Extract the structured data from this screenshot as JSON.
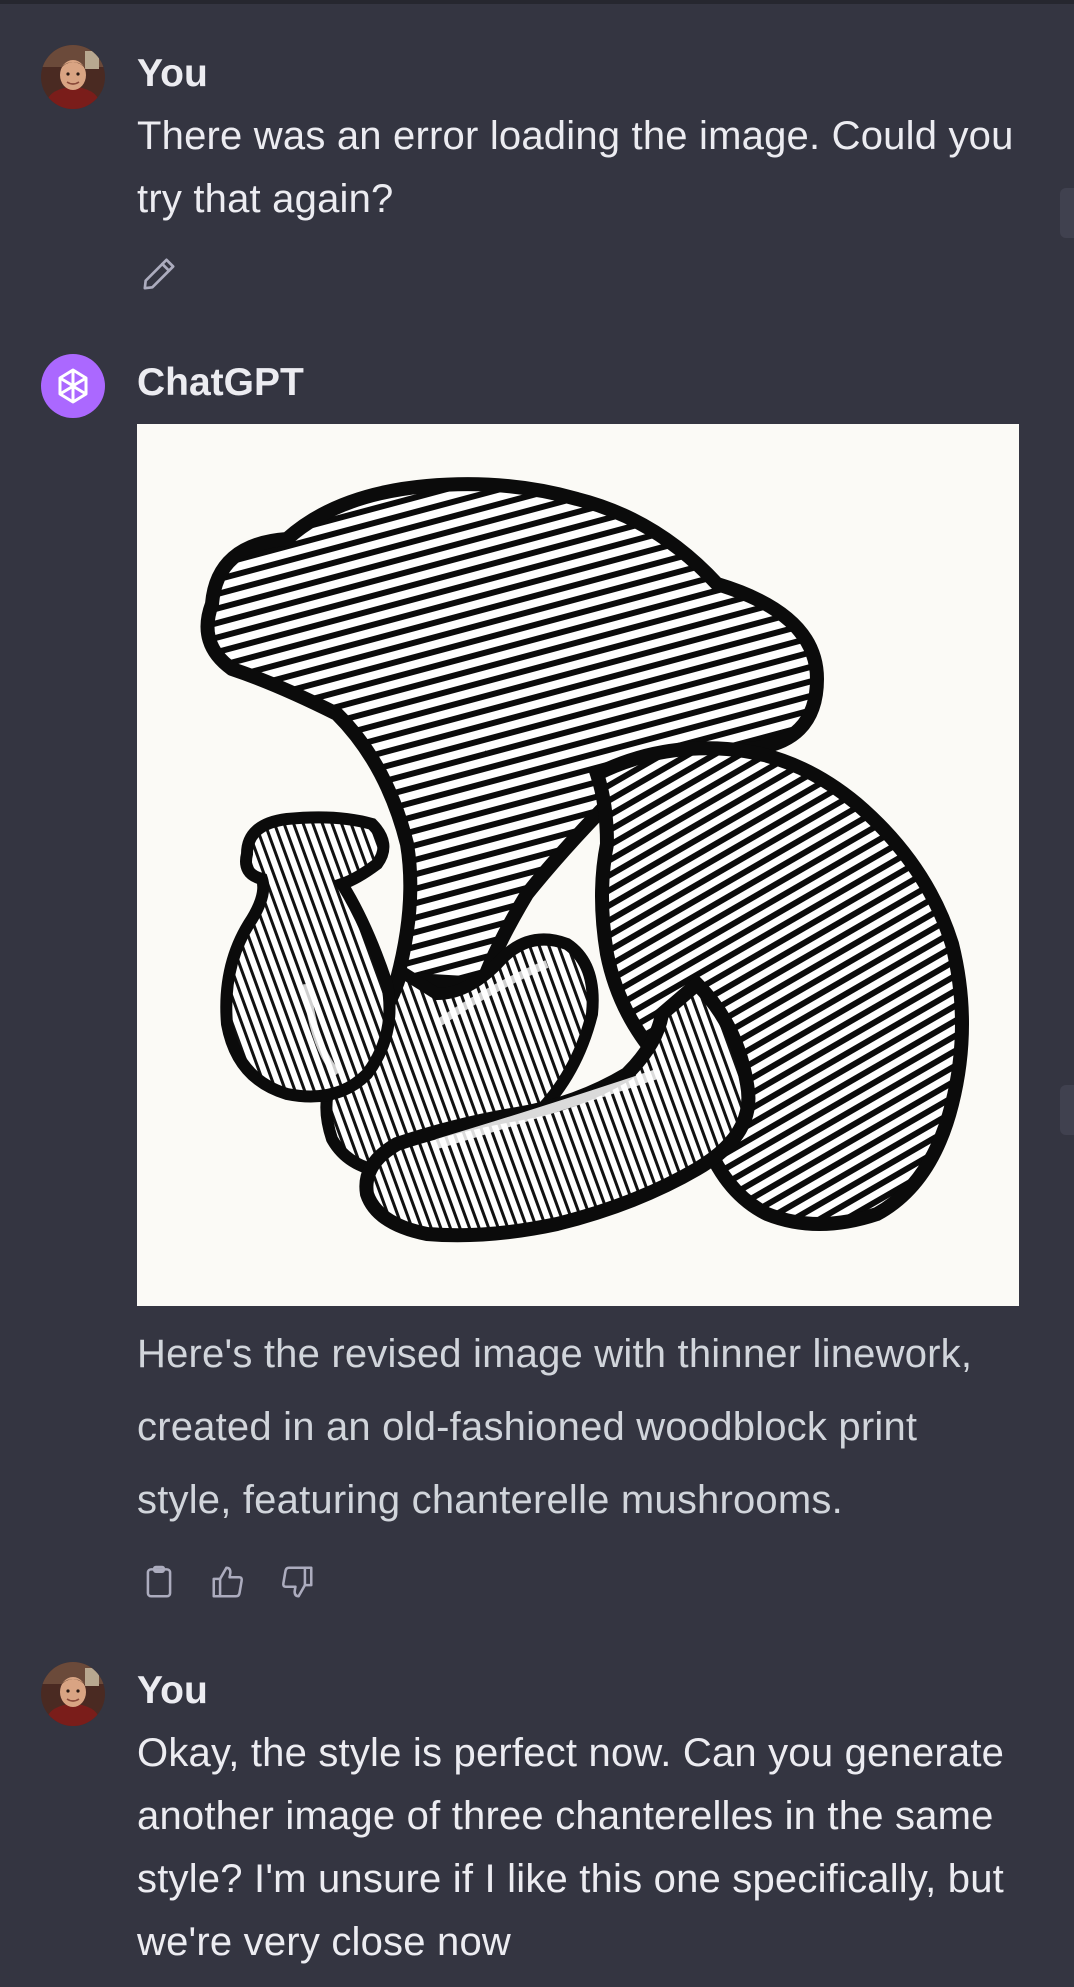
{
  "conversation": {
    "messages": [
      {
        "author": "You",
        "text": "There was an error loading the image.  Could you try that again?"
      },
      {
        "author": "ChatGPT",
        "image_alt": "",
        "text": "Here's the revised image with thinner linework, created in an old-fashioned woodblock print style, featuring chanterelle mushrooms."
      },
      {
        "author": "You",
        "text": "Okay, the style is perfect now.  Can you generate another image of three chanterelles in the same style?  I'm unsure if I like this one specifically, but we're very close now"
      }
    ]
  },
  "icons": {
    "edit": "pencil-icon",
    "copy": "clipboard-icon",
    "like": "thumbs-up-icon",
    "dislike": "thumbs-down-icon",
    "assistant_logo": "openai-logo-icon"
  },
  "colors": {
    "background": "#343541",
    "text": "#ececf1",
    "assistant_text": "#d1d5db",
    "assistant_avatar": "#ab68ff",
    "icon": "#acacbe"
  }
}
